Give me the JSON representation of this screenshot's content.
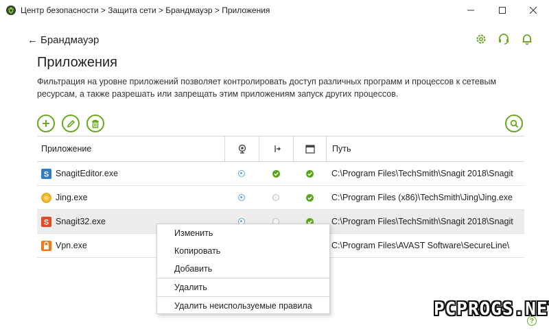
{
  "window": {
    "title": "Центр безопасности > Защита сети > Брандмауэр > Приложения",
    "controls": [
      "minimize-icon",
      "maximize-icon",
      "close-icon"
    ]
  },
  "nav": {
    "back_label": "Брандмауэр",
    "icons": [
      "gear-icon",
      "headset-icon",
      "bell-icon"
    ]
  },
  "page": {
    "title": "Приложения",
    "description": "Фильтрация на уровне приложений позволяет контролировать доступ различных программ и процессов к сетевым ресурсам, а также разрешать или запрещать этим приложениям запуск других процессов."
  },
  "toolbar": {
    "icons": [
      "add-icon",
      "edit-icon",
      "delete-icon",
      "search-icon"
    ]
  },
  "table": {
    "headers": {
      "app": "Приложение",
      "net_icon": "network-icon",
      "proc_icon": "process-start-icon",
      "win_icon": "window-icon",
      "path": "Путь"
    },
    "rows": [
      {
        "name": "SnagitEditor.exe",
        "icon": "snagit-icon",
        "net": "ask",
        "proc": "allow",
        "win": "allow",
        "path": "C:\\Program Files\\TechSmith\\Snagit 2018\\Snagit",
        "selected": false
      },
      {
        "name": "Jing.exe",
        "icon": "jing-icon",
        "net": "ask",
        "proc": "none",
        "win": "allow",
        "path": "C:\\Program Files (x86)\\TechSmith\\Jing\\Jing.exe",
        "selected": false
      },
      {
        "name": "Snagit32.exe",
        "icon": "snagit-red-icon",
        "net": "ask",
        "proc": "none",
        "win": "allow",
        "path": "C:\\Program Files\\TechSmith\\Snagit 2018\\Snagit",
        "selected": true
      },
      {
        "name": "Vpn.exe",
        "icon": "vpn-icon",
        "net": "",
        "proc": "",
        "win": "",
        "path": "C:\\Program Files\\AVAST Software\\SecureLine\\",
        "selected": false
      }
    ]
  },
  "context_menu": {
    "items": [
      "Изменить",
      "Копировать",
      "Добавить",
      "Удалить",
      "Удалить неиспользуемые правила"
    ]
  },
  "watermark": "PCPROGS.NET",
  "colors": {
    "accent": "#6aa820",
    "ask": "#5ba7d6",
    "allow": "#5aa51c"
  }
}
